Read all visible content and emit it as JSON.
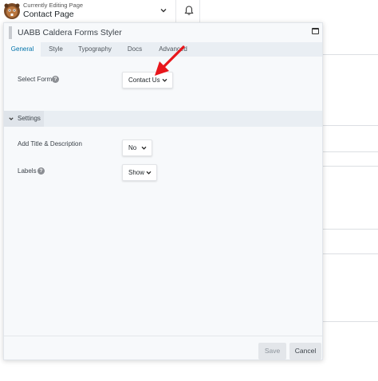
{
  "topbar": {
    "editing_small": "Currently Editing Page",
    "editing_title": "Contact Page"
  },
  "panel": {
    "title": "UABB Caldera Forms Styler",
    "tabs": [
      {
        "label": "General"
      },
      {
        "label": "Style"
      },
      {
        "label": "Typography"
      },
      {
        "label": "Docs"
      },
      {
        "label": "Advanced"
      }
    ],
    "active_tab": "General",
    "select_form": {
      "label": "Select Form",
      "value": "Contact Us"
    },
    "section": {
      "label": "Settings"
    },
    "add_title": {
      "label": "Add Title & Description",
      "value": "No"
    },
    "labels": {
      "label": "Labels",
      "value": "Show"
    },
    "save_label": "Save",
    "cancel_label": "Cancel"
  },
  "colors": {
    "accent": "#0073aa",
    "arrow": "#e8161b",
    "panel_bg": "#f7f9fb",
    "tabs_bg": "#e9eef3"
  },
  "icons": [
    "beaver-logo-icon",
    "chevron-down-icon",
    "bell-icon",
    "drag-handle-icon",
    "maximize-icon",
    "help-icon",
    "red-arrow-icon"
  ]
}
